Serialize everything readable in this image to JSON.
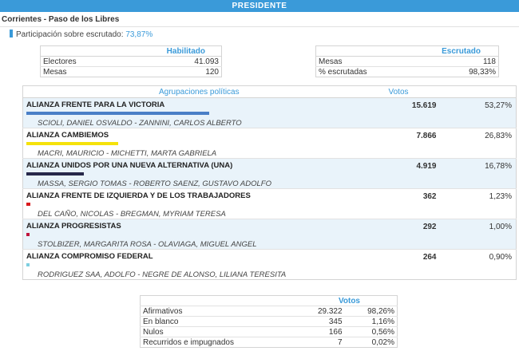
{
  "header": {
    "title": "PRESIDENTE"
  },
  "location": "Corrientes - Paso de los Libres",
  "participation": {
    "label": "Participación sobre escrutado:",
    "value": "73,87%"
  },
  "habilitado": {
    "title": "Habilitado",
    "rows": [
      {
        "label": "Electores",
        "value": "41.093"
      },
      {
        "label": "Mesas",
        "value": "120"
      }
    ]
  },
  "escrutado": {
    "title": "Escrutado",
    "rows": [
      {
        "label": "Mesas",
        "value": "118"
      },
      {
        "label": "% escrutadas",
        "value": "98,33%"
      }
    ]
  },
  "results": {
    "col_party": "Agrupaciones políticas",
    "col_votes": "Votos",
    "parties": [
      {
        "name": "ALIANZA FRENTE PARA LA VICTORIA",
        "candidates": "SCIOLI, DANIEL OSVALDO - ZANNINI, CARLOS ALBERTO",
        "votes": "15.619",
        "pct": "53,27%",
        "share": 53.27,
        "color": "#4a7fc7"
      },
      {
        "name": "ALIANZA CAMBIEMOS",
        "candidates": "MACRI, MAURICIO - MICHETTI, MARTA GABRIELA",
        "votes": "7.866",
        "pct": "26,83%",
        "share": 26.83,
        "color": "#f5e20a"
      },
      {
        "name": "ALIANZA UNIDOS POR UNA NUEVA ALTERNATIVA (UNA)",
        "candidates": "MASSA, SERGIO TOMAS - ROBERTO SAENZ, GUSTAVO ADOLFO",
        "votes": "4.919",
        "pct": "16,78%",
        "share": 16.78,
        "color": "#27284a"
      },
      {
        "name": "ALIANZA FRENTE DE IZQUIERDA Y DE LOS TRABAJADORES",
        "candidates": "DEL CAÑO, NICOLAS - BREGMAN, MYRIAM TERESA",
        "votes": "362",
        "pct": "1,23%",
        "share": 1.23,
        "color": "#d9191c"
      },
      {
        "name": "ALIANZA PROGRESISTAS",
        "candidates": "STOLBIZER, MARGARITA ROSA - OLAVIAGA, MIGUEL ANGEL",
        "votes": "292",
        "pct": "1,00%",
        "share": 1.0,
        "color": "#c0143c"
      },
      {
        "name": "ALIANZA COMPROMISO FEDERAL",
        "candidates": "RODRIGUEZ SAA, ADOLFO - NEGRE DE ALONSO, LILIANA TERESITA",
        "votes": "264",
        "pct": "0,90%",
        "share": 0.9,
        "color": "#7ecfe0"
      }
    ]
  },
  "summary": {
    "title": "Votos",
    "rows": [
      {
        "label": "Afirmativos",
        "votes": "29.322",
        "pct": "98,26%"
      },
      {
        "label": "En blanco",
        "votes": "345",
        "pct": "1,16%"
      },
      {
        "label": "Nulos",
        "votes": "166",
        "pct": "0,56%"
      },
      {
        "label": "Recurridos e impugnados",
        "votes": "7",
        "pct": "0,02%"
      }
    ]
  }
}
